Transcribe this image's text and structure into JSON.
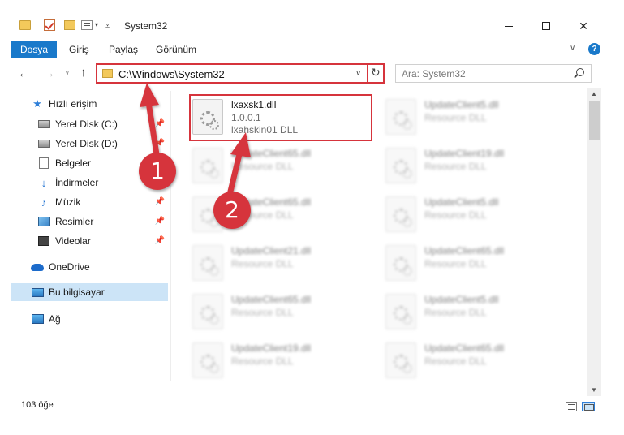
{
  "window": {
    "title": "System32"
  },
  "ribbon": {
    "file_tab": "Dosya",
    "tabs": [
      "Giriş",
      "Paylaş",
      "Görünüm"
    ],
    "help": "?"
  },
  "navigation": {
    "address_path": "C:\\Windows\\System32",
    "search_placeholder": "Ara: System32"
  },
  "sidebar": {
    "items": [
      {
        "label": "Hızlı erişim",
        "icon": "star-icon"
      },
      {
        "label": "Yerel Disk (C:)",
        "icon": "disk-icon",
        "pinned": true
      },
      {
        "label": "Yerel Disk (D:)",
        "icon": "disk-icon",
        "pinned": true
      },
      {
        "label": "Belgeler",
        "icon": "documents-icon",
        "pinned": true
      },
      {
        "label": "İndirmeler",
        "icon": "download-icon",
        "pinned": true
      },
      {
        "label": "Müzik",
        "icon": "music-icon",
        "pinned": true
      },
      {
        "label": "Resimler",
        "icon": "pictures-icon",
        "pinned": true
      },
      {
        "label": "Videolar",
        "icon": "video-icon",
        "pinned": true
      },
      {
        "label": "OneDrive",
        "icon": "cloud-icon"
      },
      {
        "label": "Bu bilgisayar",
        "icon": "pc-icon",
        "selected": true
      },
      {
        "label": "Ağ",
        "icon": "network-icon"
      }
    ]
  },
  "files": {
    "highlighted": {
      "name": "lxaxsk1.dll",
      "version": "1.0.0.1",
      "description": "lxahskin01 DLL"
    },
    "others": [
      {
        "name": "UpdateClient5.dll",
        "description": "Resource DLL"
      },
      {
        "name": "UpdateClient65.dll",
        "description": "Resource DLL"
      },
      {
        "name": "UpdateClient19.dll",
        "description": "Resource DLL"
      },
      {
        "name": "UpdateClient65.dll",
        "description": "Resource DLL"
      },
      {
        "name": "UpdateClient5.dll",
        "description": "Resource DLL"
      },
      {
        "name": "UpdateClient21.dll",
        "description": "Resource DLL"
      },
      {
        "name": "UpdateClient65.dll",
        "description": "Resource DLL"
      },
      {
        "name": "UpdateClient65.dll",
        "description": "Resource DLL"
      },
      {
        "name": "UpdateClient5.dll",
        "description": "Resource DLL"
      },
      {
        "name": "UpdateClient19.dll",
        "description": "Resource DLL"
      },
      {
        "name": "UpdateClient65.dll",
        "description": "Resource DLL"
      }
    ]
  },
  "status": {
    "item_count": "103 öğe"
  },
  "annotations": {
    "step1": "1",
    "step2": "2",
    "color": "#d6343c"
  }
}
